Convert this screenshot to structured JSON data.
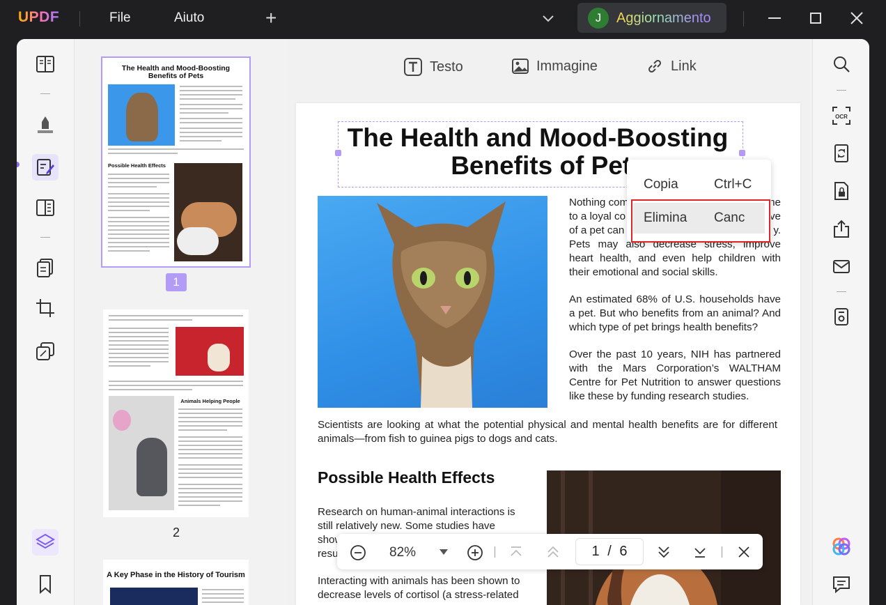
{
  "app": {
    "logo": "UPDF"
  },
  "menu": {
    "file": "File",
    "help": "Aiuto"
  },
  "upgrade": {
    "avatar_letter": "J",
    "label": "Aggiornamento"
  },
  "toolbar": {
    "text": "Testo",
    "image": "Immagine",
    "link": "Link"
  },
  "thumbnails": [
    {
      "page": "1",
      "title": "The Health and Mood-Boosting Benefits of Pets",
      "heading": "Possible Health Effects"
    },
    {
      "page": "2",
      "heading": "Animals Helping People"
    },
    {
      "heading": "A Key Phase in the History of Tourism"
    }
  ],
  "document": {
    "title_line1": "The Health and Mood-Boosting",
    "title_line2": "Benefits of Pets",
    "p1_line1": "Nothing com",
    "p1_line1_end": "he",
    "p1_line2": "to a loyal co",
    "p1_line2_end": "ve",
    "p1_line3": "of a pet can",
    "p1_line3_end": "y.",
    "p1_rest": "Pets may also decrease stress, improve heart health, and even help children with their emotional and social skills.",
    "p2": "An estimated 68% of U.S. households have a pet. But who benefits from an animal? And which type of pet brings health benefits?",
    "p3": "Over the past 10 years, NIH has partnered with the Mars Corporation’s WALTHAM Centre for Pet Nutrition to answer questions like these by funding research studies.",
    "p4": "Scientists are looking at what the potential physical and mental health benefits are for different animals—from fish to guinea pigs to dogs and cats.",
    "h2": "Possible Health Effects",
    "p5_line1": "Research on human-animal interactions is",
    "p5_line2": "still relatively new. Some studies have",
    "p5_line3": "show",
    "p5_line4": "resul",
    "p6_line1": "Interacting with animals has been shown to",
    "p6_line2": "decrease levels of cortisol (a stress-related"
  },
  "context_menu": {
    "copy_label": "Copia",
    "copy_shortcut": "Ctrl+C",
    "delete_label": "Elimina",
    "delete_shortcut": "Canc"
  },
  "zoom_bar": {
    "zoom": "82%",
    "current_page": "1",
    "separator": "/",
    "total_pages": "6"
  },
  "colors": {
    "accent": "#b39cf6",
    "highlight_box": "#e02424",
    "dark_chrome": "#1f1f21"
  }
}
